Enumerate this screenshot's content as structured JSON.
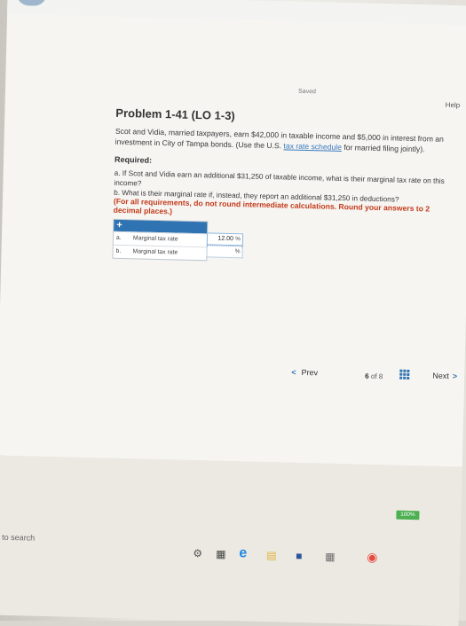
{
  "header": {
    "saved_label": "Saved",
    "help_label": "Help"
  },
  "problem": {
    "title": "Problem 1-41 (LO 1-3)",
    "intro_1": "Scot and Vidia, married taxpayers, earn $42,000 in taxable income and $5,000 in interest from an investment in City of Tampa bonds. (Use the U.S. ",
    "intro_link": "tax rate schedule",
    "intro_2": " for married filing jointly).",
    "required_label": "Required:",
    "question_a": "a. If Scot and Vidia earn an additional $31,250 of taxable income, what is their marginal tax rate on this income?",
    "question_b": "b. What is their marginal rate if, instead, they report an additional $31,250 in deductions?",
    "note": "(For all requirements, do not round intermediate calculations. Round your answers to 2 decimal places.)"
  },
  "answer_table": {
    "rows": [
      {
        "index": "a.",
        "label": "Marginal tax rate",
        "value": "12.00",
        "unit": "%"
      },
      {
        "index": "b.",
        "label": "Marginal tax rate",
        "value": "",
        "unit": "%"
      }
    ]
  },
  "pagination": {
    "prev_label": "Prev",
    "current": "6",
    "of_label": "of",
    "total": "8",
    "next_label": "Next"
  },
  "taskbar": {
    "search_text": "ne to search",
    "battery": "100%"
  },
  "icons": {
    "plus": "+",
    "chevron_left": "<",
    "chevron_right": ">"
  },
  "colors": {
    "accent": "#2f73b2",
    "note": "#c43c1c"
  }
}
